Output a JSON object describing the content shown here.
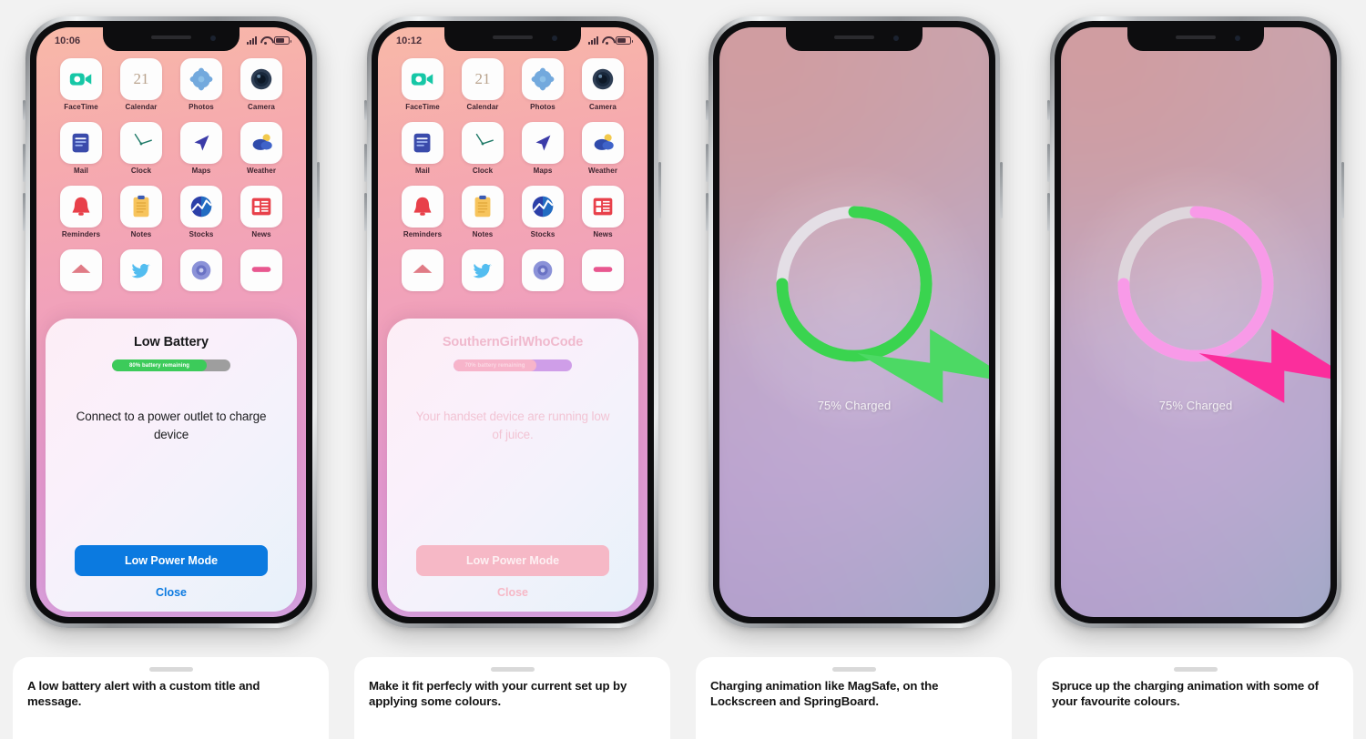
{
  "page": {
    "background": "#f2f2f2",
    "panel_count": 4
  },
  "panels": [
    {
      "id": "panel-low-battery-default",
      "screen_type": "springboard-with-alert",
      "status_bar": {
        "time": "10:06",
        "signal_icon": "cellular-bars-icon",
        "wifi_icon": "wifi-icon",
        "battery_icon": "battery-icon"
      },
      "alert": {
        "tinted": false,
        "title": "Low Battery",
        "progress_label": "80% battery remaining",
        "progress_percent": 80,
        "progress_fill_color": "#3ccb5a",
        "progress_track_color": "#9e9e9e",
        "message": "Connect to a power outlet to charge device",
        "primary_button": "Low Power Mode",
        "primary_button_color": "#0b7ae0",
        "close_button": "Close"
      },
      "caption": "A low battery alert with a custom title and message."
    },
    {
      "id": "panel-low-battery-tinted",
      "screen_type": "springboard-with-alert",
      "status_bar": {
        "time": "10:12",
        "signal_icon": "cellular-bars-icon",
        "wifi_icon": "wifi-icon",
        "battery_icon": "battery-icon"
      },
      "alert": {
        "tinted": true,
        "title": "SouthernGirlWhoCode",
        "progress_label": "70% battery remaining",
        "progress_percent": 70,
        "progress_fill_color": "#f7b4ca",
        "progress_track_color": "#cf9ee8",
        "message": "Your handset device are running low of juice.",
        "primary_button": "Low Power Mode",
        "primary_button_color": "#f6b8c6",
        "close_button": "Close"
      },
      "caption": "Make it fit perfecly with your current set up by applying some colours."
    },
    {
      "id": "panel-charging-green",
      "screen_type": "lockscreen-charging",
      "charging": {
        "percent": 75,
        "label": "75% Charged",
        "ring_color": "#3ad44f",
        "track_color": "#e4dfe6",
        "bolt_color": "#4cd964",
        "bolt_icon": "lightning-bolt-icon"
      },
      "caption": "Charging animation like MagSafe, on the Lockscreen and SpringBoard."
    },
    {
      "id": "panel-charging-pink",
      "screen_type": "lockscreen-charging",
      "charging": {
        "percent": 75,
        "label": "75% Charged",
        "ring_color": "#f89ae8",
        "track_color": "#ded6dc",
        "bolt_color": "#fb2e9c",
        "bolt_icon": "lightning-bolt-icon"
      },
      "caption": "Spruce up the charging animation with some of your favourite colours."
    }
  ],
  "springboard": {
    "rows": [
      [
        {
          "label": "FaceTime",
          "icon": "facetime-icon"
        },
        {
          "label": "Calendar",
          "icon": "calendar-icon",
          "day": "21"
        },
        {
          "label": "Photos",
          "icon": "photos-icon"
        },
        {
          "label": "Camera",
          "icon": "camera-icon"
        }
      ],
      [
        {
          "label": "Mail",
          "icon": "mail-icon"
        },
        {
          "label": "Clock",
          "icon": "clock-icon"
        },
        {
          "label": "Maps",
          "icon": "maps-icon"
        },
        {
          "label": "Weather",
          "icon": "weather-icon"
        }
      ],
      [
        {
          "label": "Reminders",
          "icon": "reminders-icon"
        },
        {
          "label": "Notes",
          "icon": "notes-icon"
        },
        {
          "label": "Stocks",
          "icon": "stocks-icon"
        },
        {
          "label": "News",
          "icon": "news-icon"
        }
      ],
      [
        {
          "label": "",
          "icon": "home-icon"
        },
        {
          "label": "",
          "icon": "twitter-icon"
        },
        {
          "label": "",
          "icon": "settings-icon"
        },
        {
          "label": "",
          "icon": "music-icon"
        }
      ]
    ]
  }
}
